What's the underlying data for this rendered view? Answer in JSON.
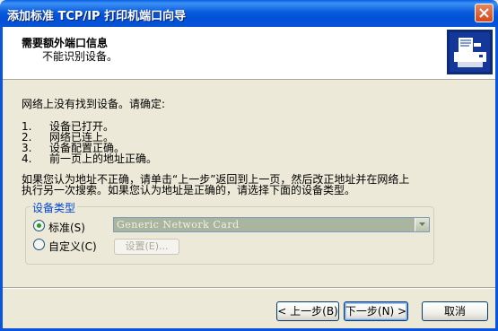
{
  "window": {
    "title": "添加标准 TCP/IP 打印机端口向导"
  },
  "header": {
    "title": "需要额外端口信息",
    "subtitle": "不能识别设备。"
  },
  "intro": "网络上没有找到设备。请确定:",
  "checklist": [
    {
      "num": "1.",
      "text": "设备已打开。"
    },
    {
      "num": "2.",
      "text": "网络已连上。"
    },
    {
      "num": "3.",
      "text": "设备配置正确。"
    },
    {
      "num": "4.",
      "text": "前一页上的地址正确。"
    }
  ],
  "note_lines": [
    "如果您认为地址不正确，请单击“上一步”返回到上一页，然后改正地址并在网络上",
    "执行另一次搜索。如果您认为地址是正确的，请选择下面的设备类型。"
  ],
  "device_type": {
    "group_title": "设备类型",
    "standard_label": "标准(S)",
    "custom_label": "自定义(C)",
    "selected": "standard",
    "standard_value": "Generic Network Card",
    "settings_label": "设置(E)..."
  },
  "buttons": {
    "back": "< 上一步(B)",
    "next": "下一步(N) >",
    "cancel": "取消"
  }
}
